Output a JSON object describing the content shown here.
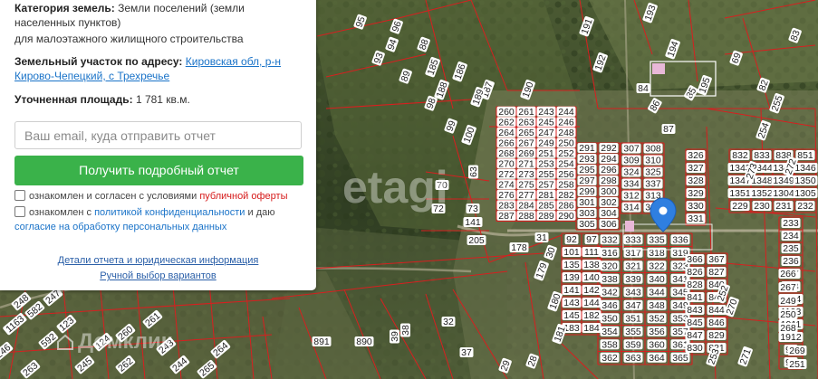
{
  "panel": {
    "category_label": "Категория земель:",
    "category_value_1": "Земли поселений (земли",
    "category_value_2": "населенных пунктов)",
    "category_value_3": "для малоэтажного жилищного строительства",
    "address_label": "Земельный участок по адресу:",
    "address_link_1": "Кировская обл, р-н",
    "address_link_2": "Кирово-Чепецкий, с Трехречье",
    "area_label": "Уточненная площадь:",
    "area_value": "1 781 кв.м.",
    "email_placeholder": "Ваш email, куда отправить отчет",
    "submit_label": "Получить подробный отчет",
    "consent1_text": "ознакомлен и согласен с условиями ",
    "consent1_link": "публичной оферты",
    "consent2_text_1": "ознакомлен с ",
    "consent2_link_1": "политикой конфиденциальности",
    "consent2_text_2": " и даю",
    "consent2_link_2": "согласие на обработку персональных данных",
    "details_link": "Детали отчета и юридическая информация",
    "manual_link": "Ручной выбор вариантов"
  },
  "watermarks": {
    "etagi": "etagi",
    "domclick": "Домклик"
  },
  "colors": {
    "button": "#3ab24a",
    "link": "#1a73c8",
    "offer_link": "#d61a1a",
    "parcel_line": "#d81f1f",
    "marker": "#2f7fe0"
  },
  "map_labels": [
    "260",
    "261",
    "243",
    "244",
    "262",
    "263",
    "245",
    "246",
    "264",
    "265",
    "247",
    "248",
    "266",
    "267",
    "249",
    "250",
    "268",
    "269",
    "251",
    "252",
    "270",
    "271",
    "253",
    "254",
    "272",
    "273",
    "255",
    "256",
    "274",
    "275",
    "257",
    "258",
    "276",
    "277",
    "281",
    "282",
    "283",
    "284",
    "285",
    "286",
    "287",
    "288",
    "289",
    "290",
    "291",
    "292",
    "293",
    "294",
    "295",
    "296",
    "297",
    "298",
    "299",
    "300",
    "301",
    "302",
    "303",
    "304",
    "305",
    "306",
    "307",
    "308",
    "309",
    "310",
    "324",
    "325",
    "334",
    "337",
    "312",
    "313",
    "314",
    "315",
    "326",
    "327",
    "328",
    "329",
    "330",
    "331",
    "332",
    "333",
    "335",
    "336",
    "316",
    "317",
    "318",
    "319",
    "320",
    "321",
    "322",
    "323",
    "338",
    "339",
    "340",
    "341",
    "342",
    "343",
    "344",
    "345",
    "346",
    "347",
    "348",
    "349",
    "350",
    "351",
    "352",
    "353",
    "354",
    "355",
    "356",
    "357",
    "358",
    "359",
    "360",
    "361",
    "362",
    "363",
    "364",
    "365",
    "366",
    "367",
    "826",
    "827",
    "828",
    "840",
    "841",
    "842",
    "843",
    "844",
    "845",
    "846",
    "847",
    "829",
    "830",
    "831",
    "832",
    "833",
    "838",
    "851",
    "1343",
    "1344",
    "1345",
    "1346",
    "1347",
    "1348",
    "1349",
    "1350",
    "1351",
    "1352",
    "1304",
    "1305",
    "229",
    "230",
    "231",
    "232",
    "233",
    "234",
    "235",
    "236",
    "237",
    "238",
    "1104",
    "1193",
    "1911",
    "1912",
    "90",
    "91",
    "92",
    "97",
    "101",
    "111",
    "135",
    "138",
    "139",
    "140",
    "141",
    "142",
    "143",
    "144",
    "145",
    "182",
    "183",
    "184",
    "185",
    "186",
    "187",
    "188",
    "189",
    "190",
    "191",
    "192",
    "193",
    "194",
    "195",
    "69",
    "82",
    "83",
    "84",
    "85",
    "86",
    "87",
    "88",
    "89",
    "93",
    "94",
    "95",
    "96",
    "98",
    "99",
    "100",
    "63",
    "70",
    "72",
    "73",
    "141",
    "205",
    "178",
    "179",
    "180",
    "181",
    "28",
    "29",
    "30",
    "31",
    "32",
    "37",
    "38",
    "39",
    "890",
    "891",
    "1163",
    "582",
    "592",
    "123",
    "124"
  ]
}
